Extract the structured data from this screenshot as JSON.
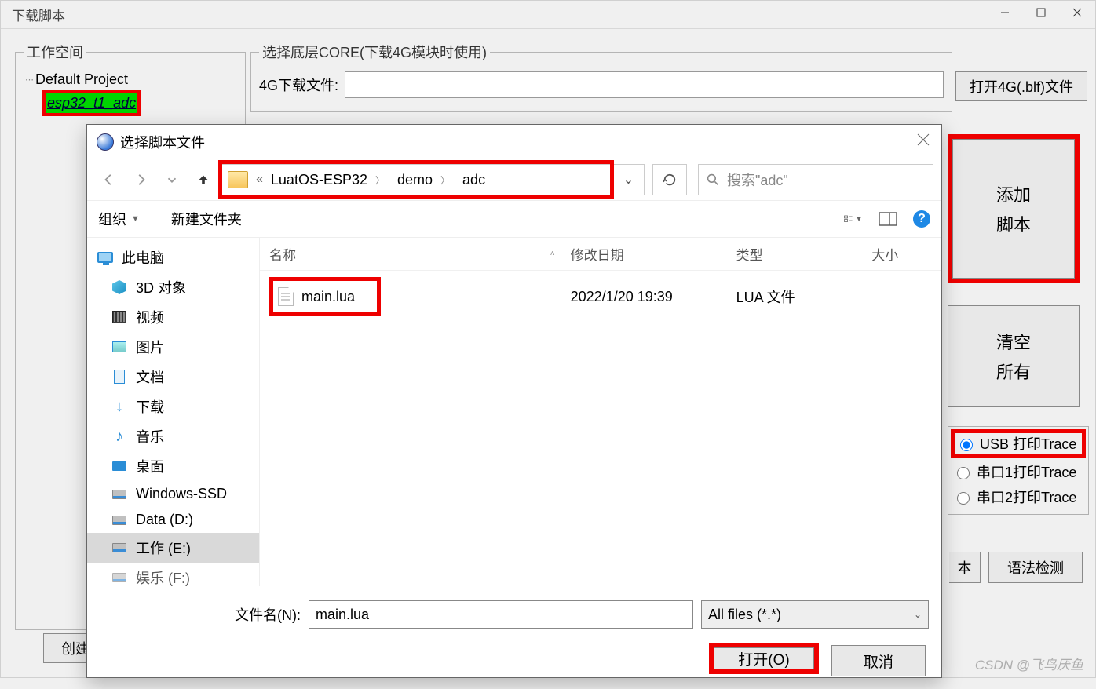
{
  "window": {
    "title": "下载脚本"
  },
  "workspace": {
    "legend": "工作空间",
    "root": "Default Project",
    "selected": "esp32_t1_adc",
    "create_btn": "创建"
  },
  "core": {
    "legend": "选择底层CORE(下载4G模块时使用)",
    "label": "4G下载文件:",
    "value": "",
    "open_btn": "打开4G(.blf)文件"
  },
  "right": {
    "add_line1": "添加",
    "add_line2": "脚本",
    "clear_line1": "清空",
    "clear_line2": "所有",
    "radios": {
      "usb": "USB 打印Trace",
      "com1": "串口1打印Trace",
      "com2": "串口2打印Trace"
    },
    "stub_btn": "本",
    "syntax_btn": "语法检测"
  },
  "dialog": {
    "title": "选择脚本文件",
    "breadcrumb": {
      "seg1": "LuatOS-ESP32",
      "seg2": "demo",
      "seg3": "adc"
    },
    "search_placeholder": "搜索\"adc\"",
    "toolbar": {
      "organize": "组织",
      "new_folder": "新建文件夹"
    },
    "sidebar": {
      "this_pc": "此电脑",
      "3d": "3D 对象",
      "video": "视频",
      "pic": "图片",
      "doc": "文档",
      "download": "下载",
      "music": "音乐",
      "desktop": "桌面",
      "win_ssd": "Windows-SSD",
      "data_d": "Data (D:)",
      "work_e": "工作 (E:)",
      "ent_f": "娱乐 (F:)"
    },
    "columns": {
      "name": "名称",
      "date": "修改日期",
      "type": "类型",
      "size": "大小"
    },
    "file": {
      "name": "main.lua",
      "date": "2022/1/20 19:39",
      "type": "LUA 文件",
      "size": ""
    },
    "filename_label": "文件名(N):",
    "filename_value": "main.lua",
    "filetype": "All files (*.*)",
    "open_btn": "打开(O)",
    "cancel_btn": "取消"
  },
  "watermark": "CSDN @飞鸟厌鱼"
}
